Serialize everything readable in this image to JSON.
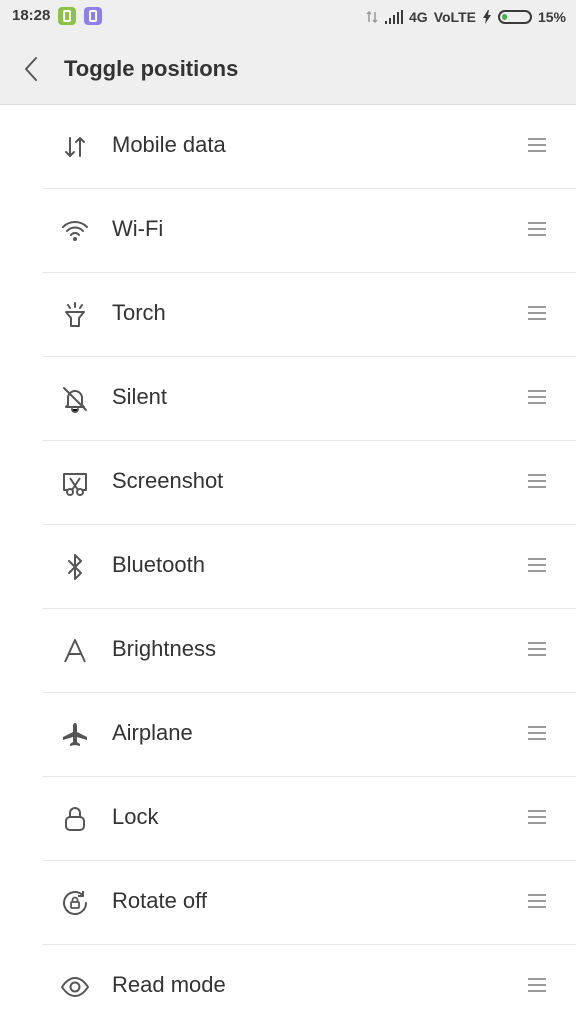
{
  "status_bar": {
    "time": "18:28",
    "network": "4G",
    "volte": "VoLTE",
    "battery": "15%"
  },
  "header": {
    "title": "Toggle positions"
  },
  "toggles": [
    {
      "label": "Mobile data",
      "icon": "mobile-data-icon"
    },
    {
      "label": "Wi-Fi",
      "icon": "wifi-icon"
    },
    {
      "label": "Torch",
      "icon": "torch-icon"
    },
    {
      "label": "Silent",
      "icon": "silent-icon"
    },
    {
      "label": "Screenshot",
      "icon": "screenshot-icon"
    },
    {
      "label": "Bluetooth",
      "icon": "bluetooth-icon"
    },
    {
      "label": "Brightness",
      "icon": "brightness-icon"
    },
    {
      "label": "Airplane",
      "icon": "airplane-icon"
    },
    {
      "label": "Lock",
      "icon": "lock-icon"
    },
    {
      "label": "Rotate off",
      "icon": "rotate-off-icon"
    },
    {
      "label": "Read mode",
      "icon": "read-mode-icon"
    }
  ],
  "colors": {
    "header_bg": "#efefef",
    "text": "#333333",
    "divider": "#e6e6e6",
    "battery": "#4caf50"
  }
}
